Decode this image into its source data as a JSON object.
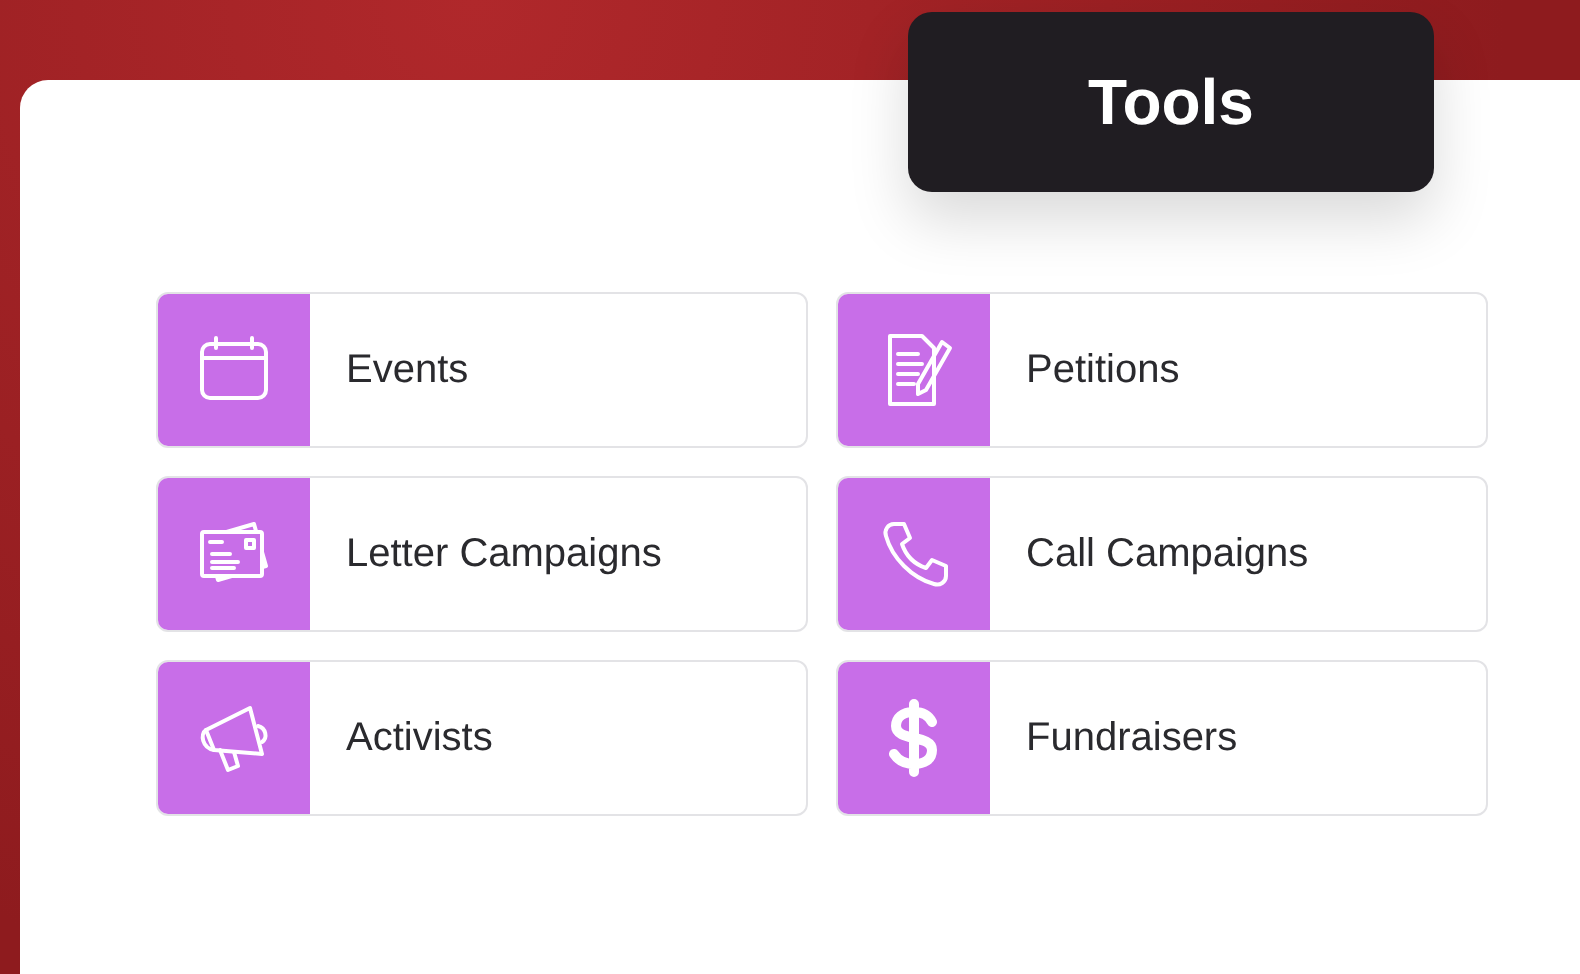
{
  "header": {
    "title": "Tools"
  },
  "tools": [
    {
      "label": "Events",
      "kind": "calendar"
    },
    {
      "label": "Petitions",
      "kind": "document"
    },
    {
      "label": "Letter Campaigns",
      "kind": "letters"
    },
    {
      "label": "Call Campaigns",
      "kind": "phone"
    },
    {
      "label": "Activists",
      "kind": "megaphone"
    },
    {
      "label": "Fundraisers",
      "kind": "dollar"
    }
  ]
}
